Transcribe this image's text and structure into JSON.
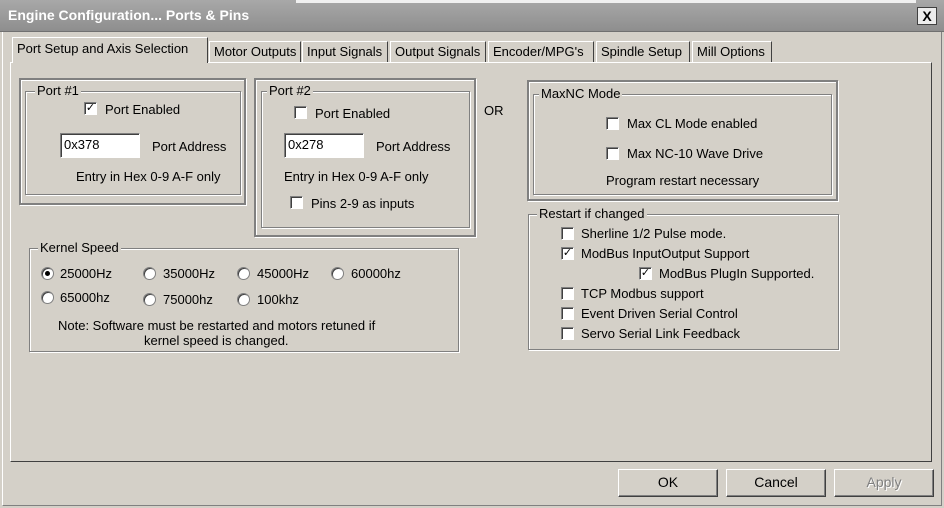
{
  "window": {
    "title": "Engine Configuration... Ports & Pins",
    "close_glyph": "X"
  },
  "tabs": [
    "Port Setup and Axis Selection",
    "Motor Outputs",
    "Input Signals",
    "Output Signals",
    "Encoder/MPG's",
    "Spindle Setup",
    "Mill Options"
  ],
  "active_tab": 0,
  "port1": {
    "title": "Port #1",
    "enabled_label": "Port Enabled",
    "enabled": true,
    "address_value": "0x378",
    "address_label": "Port Address",
    "hint": "Entry in Hex 0-9 A-F only"
  },
  "port2": {
    "title": "Port #2",
    "enabled_label": "Port Enabled",
    "enabled": false,
    "address_value": "0x278",
    "address_label": "Port Address",
    "hint": "Entry in Hex 0-9 A-F only",
    "pins_label": "Pins 2-9 as inputs",
    "pins_checked": false
  },
  "or_label": "OR",
  "maxnc": {
    "title": "MaxNC Mode",
    "cl_label": "Max CL Mode enabled",
    "cl_checked": false,
    "wave_label": "Max NC-10 Wave Drive",
    "wave_checked": false,
    "note": "Program restart necessary"
  },
  "kernel": {
    "title": "Kernel Speed",
    "options": [
      "25000Hz",
      "35000Hz",
      "45000Hz",
      "60000hz",
      "65000hz",
      "75000hz",
      "100khz"
    ],
    "selected": "25000Hz",
    "note_line1": "Note: Software must be restarted and motors retuned if",
    "note_line2": "kernel speed is changed."
  },
  "restart": {
    "title": "Restart if changed",
    "items": [
      {
        "label": "Sherline 1/2 Pulse mode.",
        "checked": false
      },
      {
        "label": "ModBus InputOutput Support",
        "checked": true
      },
      {
        "label": "ModBus PlugIn Supported.",
        "checked": true
      },
      {
        "label": "TCP Modbus support",
        "checked": false
      },
      {
        "label": "Event Driven Serial Control",
        "checked": false
      },
      {
        "label": "Servo Serial Link Feedback",
        "checked": false
      }
    ]
  },
  "buttons": {
    "ok": "OK",
    "cancel": "Cancel",
    "apply": "Apply",
    "apply_enabled": false
  },
  "check_glyph": "✓"
}
